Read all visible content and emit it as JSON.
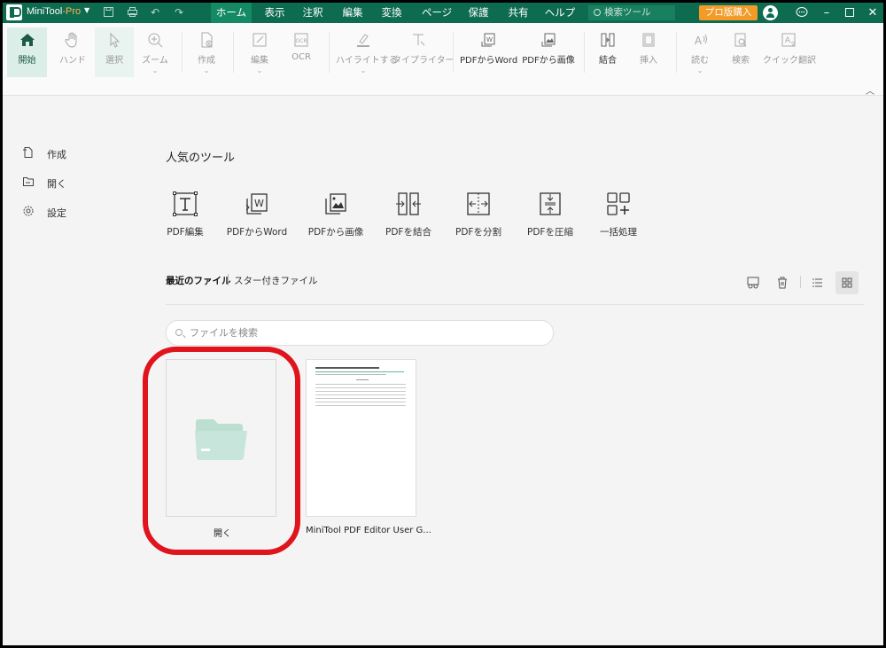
{
  "title_bar": {
    "app_name": "MiniTool",
    "app_suffix": "-Pro",
    "menus": [
      "ホーム",
      "表示",
      "注釈",
      "編集",
      "変換",
      "ページ",
      "保護",
      "共有",
      "ヘルプ"
    ],
    "active_menu": "ホーム",
    "search_tools_placeholder": "検索ツール",
    "pro_button": "プロ版購入",
    "accent_color": "#0d6b4f",
    "pro_color": "#f39b26"
  },
  "ribbon": {
    "home": "開始",
    "hand": "ハンド",
    "select": "選択",
    "zoom": "ズーム",
    "create": "作成",
    "edit": "編集",
    "ocr": "OCR",
    "highlight": "ハイライトする",
    "typewriter": "タイプライター",
    "pdf_to_word": "PDFからWord",
    "pdf_to_image": "PDFから画像",
    "merge": "結合",
    "insert": "挿入",
    "read": "読む",
    "search": "検索",
    "quick_translate": "クイック翻訳"
  },
  "sidebar": {
    "items": [
      {
        "label": "作成",
        "icon": "new-file-icon"
      },
      {
        "label": "開く",
        "icon": "folder-icon"
      },
      {
        "label": "設定",
        "icon": "gear-icon"
      }
    ]
  },
  "main": {
    "popular_title": "人気のツール",
    "tools": [
      {
        "label": "PDF編集",
        "icon": "text-edit-icon"
      },
      {
        "label": "PDFからWord",
        "icon": "pdf-to-word-icon"
      },
      {
        "label": "PDFから画像",
        "icon": "pdf-to-image-icon"
      },
      {
        "label": "PDFを結合",
        "icon": "merge-icon"
      },
      {
        "label": "PDFを分割",
        "icon": "split-icon"
      },
      {
        "label": "PDFを圧縮",
        "icon": "compress-icon"
      },
      {
        "label": "一括処理",
        "icon": "batch-icon"
      }
    ],
    "tabs": {
      "recent": "最近のファイル",
      "starred": "スター付きファイル"
    },
    "search_placeholder": "ファイルを検索",
    "files": [
      {
        "label": "開く"
      },
      {
        "label": "MiniTool PDF Editor User G..."
      }
    ]
  }
}
